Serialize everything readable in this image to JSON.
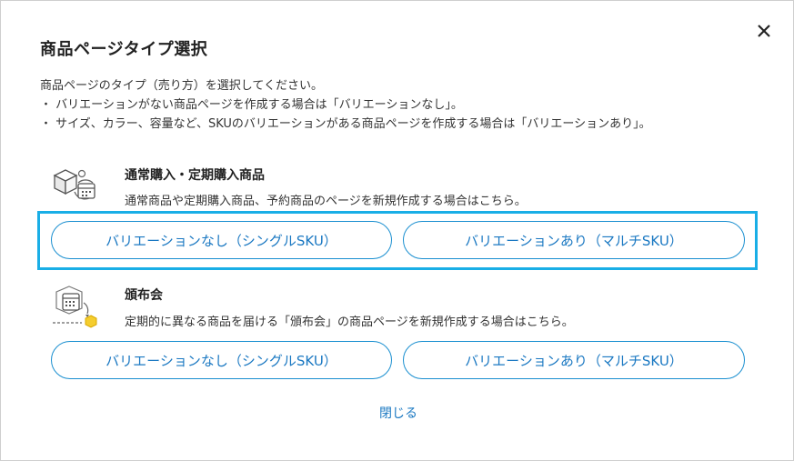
{
  "dialog": {
    "title": "商品ページタイプ選択",
    "intro": "商品ページのタイプ（売り方）を選択してください。",
    "bullet1": "・ バリエーションがない商品ページを作成する場合は「バリエーションなし」。",
    "bullet2": "・ サイズ、カラー、容量など、SKUのバリエーションがある商品ページを作成する場合は「バリエーションあり」。",
    "close_link": "閉じる"
  },
  "sections": [
    {
      "title": "通常購入・定期購入商品",
      "description": "通常商品や定期購入商品、予約商品のページを新規作成する場合はこちら。",
      "single_label": "バリエーションなし（シングルSKU）",
      "multi_label": "バリエーションあり（マルチSKU）",
      "icon": "box-calendar-icon"
    },
    {
      "title": "頒布会",
      "description": "定期的に異なる商品を届ける「頒布会」の商品ページを新規作成する場合はこちら。",
      "single_label": "バリエーションなし（シングルSKU）",
      "multi_label": "バリエーションあり（マルチSKU）",
      "icon": "calendar-subscription-icon"
    }
  ],
  "colors": {
    "accent": "#1a78c2",
    "highlight": "#19aee6",
    "icon_yellow": "#f5cd2e"
  }
}
